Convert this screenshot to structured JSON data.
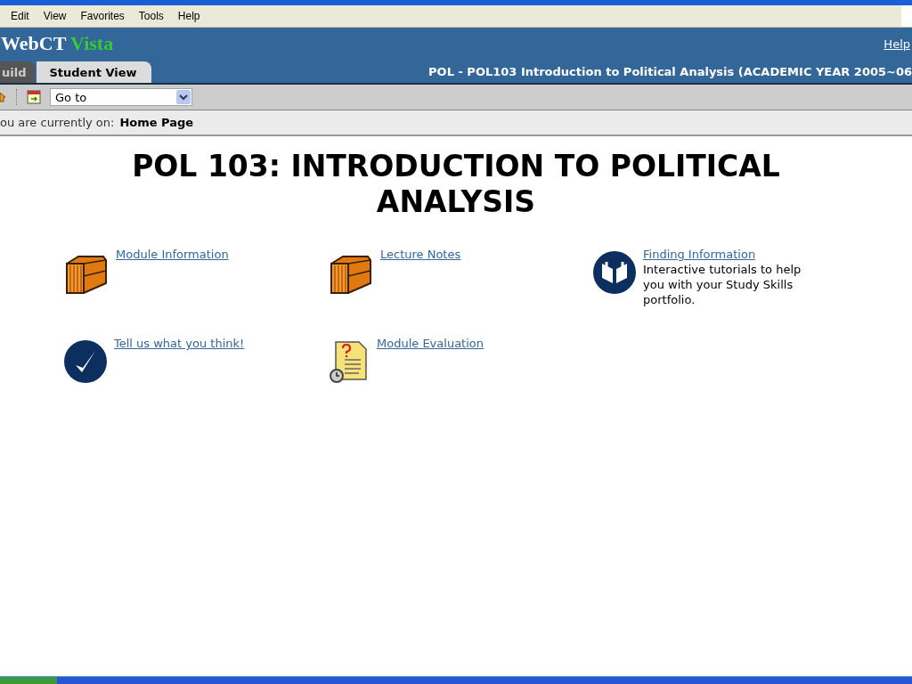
{
  "menu_bar": {
    "items": [
      "Edit",
      "View",
      "Favorites",
      "Tools",
      "Help"
    ]
  },
  "header": {
    "logo": {
      "brand": "WebCT",
      "product": "Vista"
    },
    "help_link": "Help",
    "course_title": "POL - POL103 Introduction to Political Analysis (ACADEMIC YEAR 2005~06"
  },
  "tabs": [
    {
      "label": "uild",
      "selected": false
    },
    {
      "label": "Student View",
      "selected": true
    }
  ],
  "toolbar": {
    "goto": {
      "value": "Go to"
    }
  },
  "breadcrumb": {
    "prefix": "ou are currently on:",
    "current": "Home Page"
  },
  "page": {
    "heading": "POL 103: INTRODUCTION TO POLITICAL ANALYSIS",
    "items": [
      {
        "kind": "folder",
        "link": "Module Information"
      },
      {
        "kind": "folder",
        "link": "Lecture Notes"
      },
      {
        "kind": "book",
        "link": "Finding Information",
        "description": "Interactive tutorials to help you with your Study Skills portfolio."
      },
      {
        "kind": "check",
        "link": "Tell us what you think!"
      },
      {
        "kind": "evaluation",
        "link": "Module Evaluation"
      }
    ]
  }
}
